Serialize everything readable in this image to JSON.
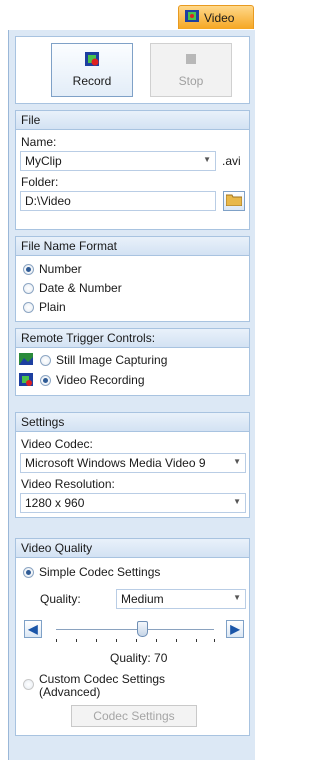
{
  "tabs": {
    "video_label": "Video"
  },
  "toolbar": {
    "record_label": "Record",
    "stop_label": "Stop"
  },
  "file": {
    "title": "File",
    "name_label": "Name:",
    "name_value": "MyClip",
    "ext": ".avi",
    "folder_label": "Folder:",
    "folder_value": "D:\\Video"
  },
  "format": {
    "title": "File Name Format",
    "options": [
      "Number",
      "Date & Number",
      "Plain"
    ],
    "selected": "Number"
  },
  "remote": {
    "title": "Remote Trigger Controls:",
    "options": [
      "Still Image Capturing",
      "Video Recording"
    ],
    "selected": "Video Recording"
  },
  "settings": {
    "title": "Settings",
    "codec_label": "Video Codec:",
    "codec_value": "Microsoft Windows Media Video 9",
    "resolution_label": "Video Resolution:",
    "resolution_value": "1280 x 960"
  },
  "quality": {
    "title": "Video Quality",
    "simple_label": "Simple Codec Settings",
    "quality_label": "Quality:",
    "quality_value": "Medium",
    "slider_text": "Quality: 70",
    "slider_value": 70,
    "custom_label_1": "Custom Codec Settings",
    "custom_label_2": "(Advanced)",
    "codec_settings_button": "Codec Settings"
  }
}
